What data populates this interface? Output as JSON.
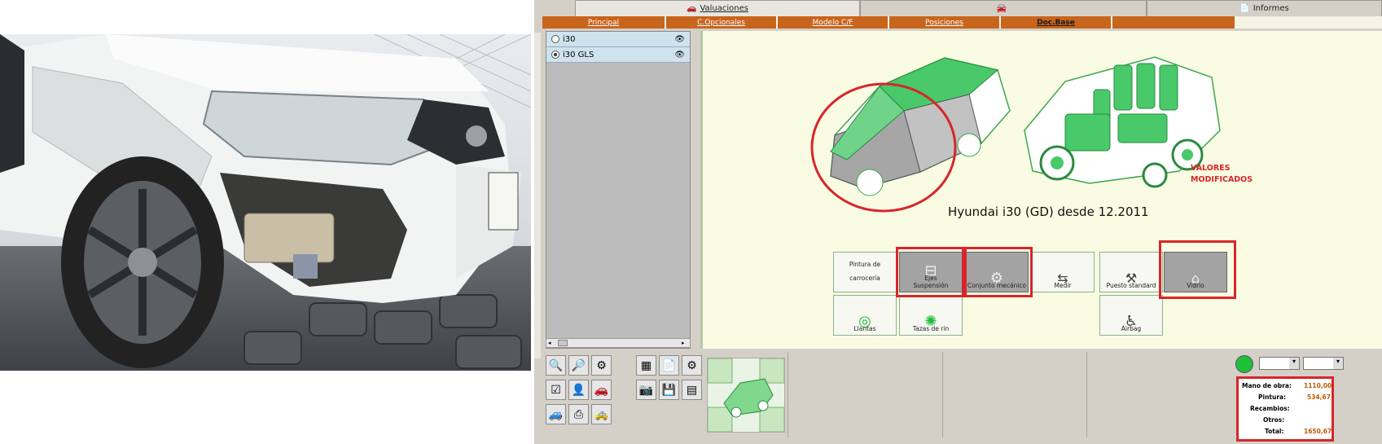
{
  "top_tabs": [
    {
      "label": "Valuaciones",
      "icon": "car-icon"
    },
    {
      "label": "",
      "icon": "car-icon"
    },
    {
      "label": "Informes",
      "icon": "document-icon"
    }
  ],
  "nav": [
    "Principal",
    "C.Opcionales",
    "Modelo C/F",
    "Posiciones",
    "Doc.Base",
    ""
  ],
  "models": [
    {
      "label": "i30",
      "selected": false
    },
    {
      "label": "i30 GLS",
      "selected": true
    }
  ],
  "vehicle_title": "Hyundai i30 (GD) desde 12.2011",
  "modified_note": [
    "VALORES",
    "MODIFICADOS"
  ],
  "buttons": {
    "pintura_l1": "Pintura de",
    "pintura_l2": "carrocería",
    "ejes": "Ejes Suspensión",
    "conjunto": "Conjunto mecánico",
    "medir": "Medir",
    "puesto": "Puesto standard",
    "vidrio": "Vidrio",
    "llantas": "Llantas",
    "tazas": "Tazas de rin",
    "airbag": "Airbag"
  },
  "totals": {
    "mano_label": "Mano de obra:",
    "mano_value": "1110,00",
    "pintura_label": "Pintura:",
    "pintura_value": "534,67",
    "recambios_label": "Recambios:",
    "recambios_value": "",
    "otros_label": "Otros:",
    "otros_value": "",
    "total_label": "Total:",
    "total_value": "1650,67"
  },
  "colors": {
    "accent": "#c8641c",
    "highlight": "#d7262a",
    "panel_green": "#1fbf3a",
    "value_orange": "#c05a00"
  }
}
